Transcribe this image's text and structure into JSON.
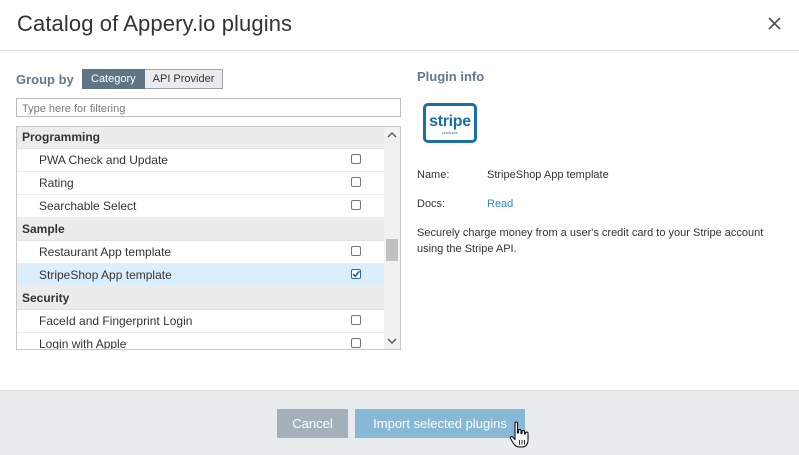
{
  "dialog": {
    "title": "Catalog of Appery.io plugins",
    "close_icon": "close-icon"
  },
  "left": {
    "group_by_label": "Group by",
    "tabs": [
      {
        "label": "Category",
        "active": true
      },
      {
        "label": "API Provider",
        "active": false
      }
    ],
    "filter_placeholder": "Type here for filtering",
    "groups": [
      {
        "label": "Programming",
        "items": [
          {
            "label": "PWA Check and Update",
            "checked": false
          },
          {
            "label": "Rating",
            "checked": false
          },
          {
            "label": "Searchable Select",
            "checked": false
          }
        ]
      },
      {
        "label": "Sample",
        "items": [
          {
            "label": "Restaurant App template",
            "checked": false
          },
          {
            "label": "StripeShop App template",
            "checked": true,
            "selected": true
          }
        ]
      },
      {
        "label": "Security",
        "items": [
          {
            "label": "FaceId and Fingerprint Login",
            "checked": false
          },
          {
            "label": "Login with Apple",
            "checked": false
          }
        ]
      }
    ]
  },
  "plugin_info": {
    "title": "Plugin info",
    "logo_text": "stripe",
    "logo_subtext": "products",
    "name_label": "Name:",
    "name_value": "StripeShop App template",
    "docs_label": "Docs:",
    "docs_link": "Read",
    "description": "Securely charge money from a user's credit card to your Stripe account using the Stripe API."
  },
  "footer": {
    "cancel_label": "Cancel",
    "import_label": "Import selected plugins"
  },
  "colors": {
    "accent": "#617a8e",
    "selected_row": "#dceefb",
    "import_button": "#87b8d6",
    "cancel_button": "#a4b1bb",
    "stripe_blue": "#1a6fa8"
  }
}
